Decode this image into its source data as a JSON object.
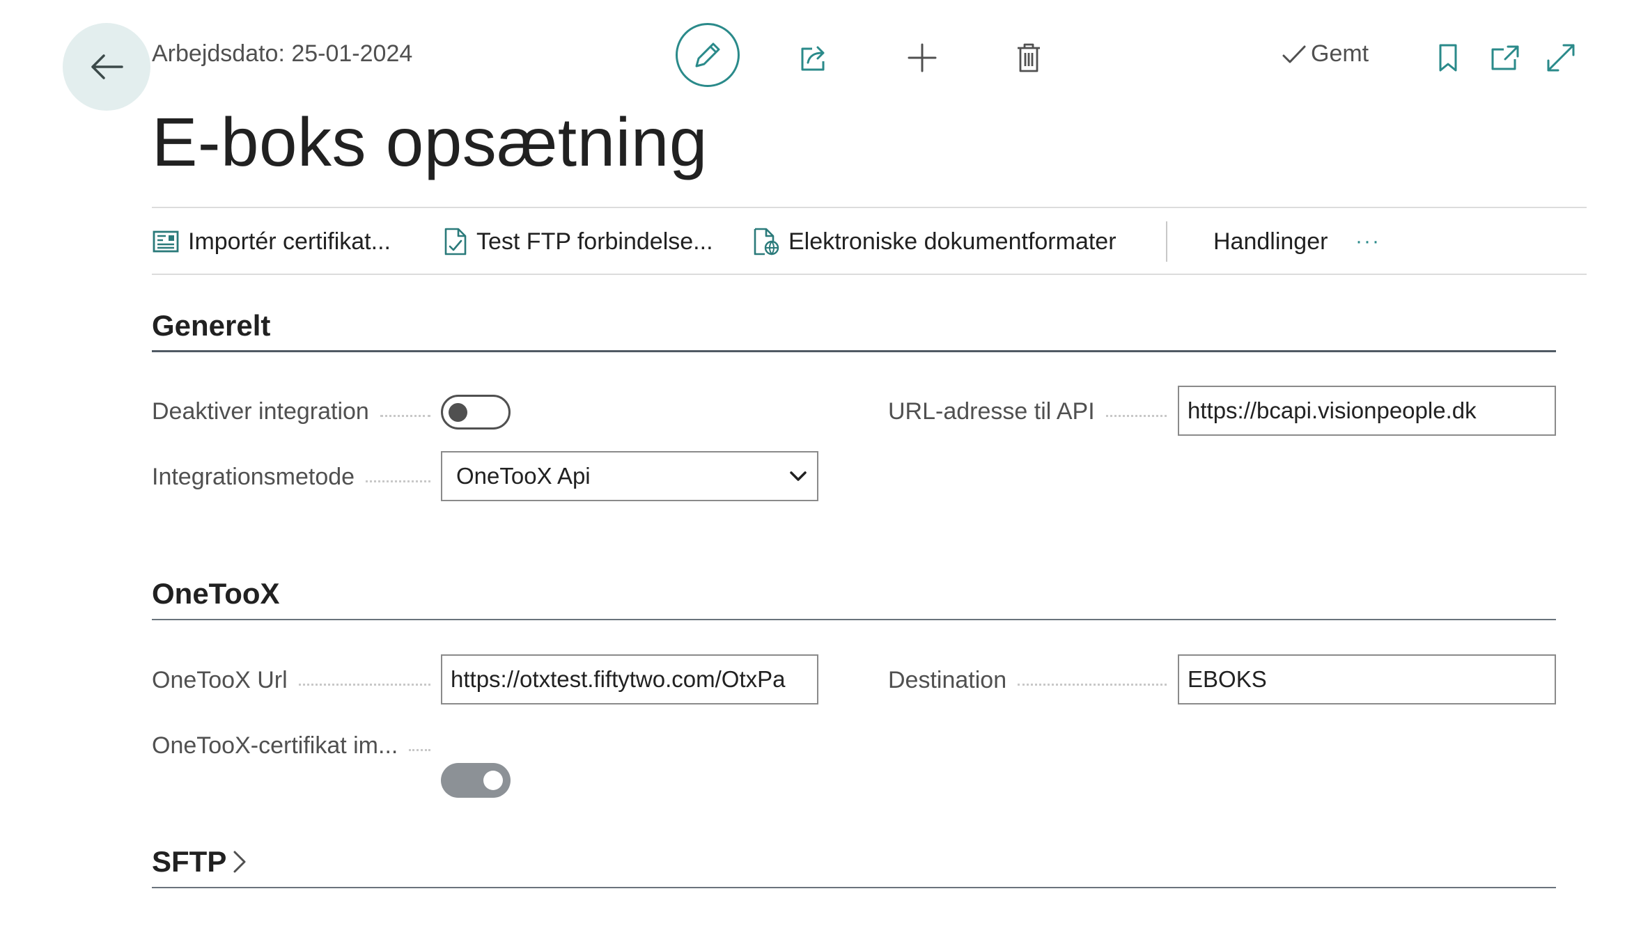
{
  "header": {
    "work_date": "Arbejdsdato: 25-01-2024",
    "saved_status": "Gemt"
  },
  "page": {
    "title": "E-boks opsætning"
  },
  "actions": {
    "import_certificate": "Importér certifikat...",
    "test_ftp": "Test FTP forbindelse...",
    "electronic_document_formats": "Elektroniske dokumentformater",
    "actions_menu": "Handlinger",
    "more": "···"
  },
  "general": {
    "title": "Generelt",
    "disable_integration": {
      "label": "Deaktiver integration",
      "value": false
    },
    "integration_method": {
      "label": "Integrationsmetode",
      "value": "OneTooX Api"
    },
    "api_url": {
      "label": "URL-adresse til API",
      "value": "https://bcapi.visionpeople.dk"
    }
  },
  "onetoox": {
    "title": "OneTooX",
    "url": {
      "label": "OneTooX Url",
      "value": "https://otxtest.fiftytwo.com/OtxPa"
    },
    "destination": {
      "label": "Destination",
      "value": "EBOKS"
    },
    "certificate_imported": {
      "label": "OneTooX-certifikat im...",
      "value": true
    }
  },
  "sftp": {
    "title": "SFTP"
  }
}
